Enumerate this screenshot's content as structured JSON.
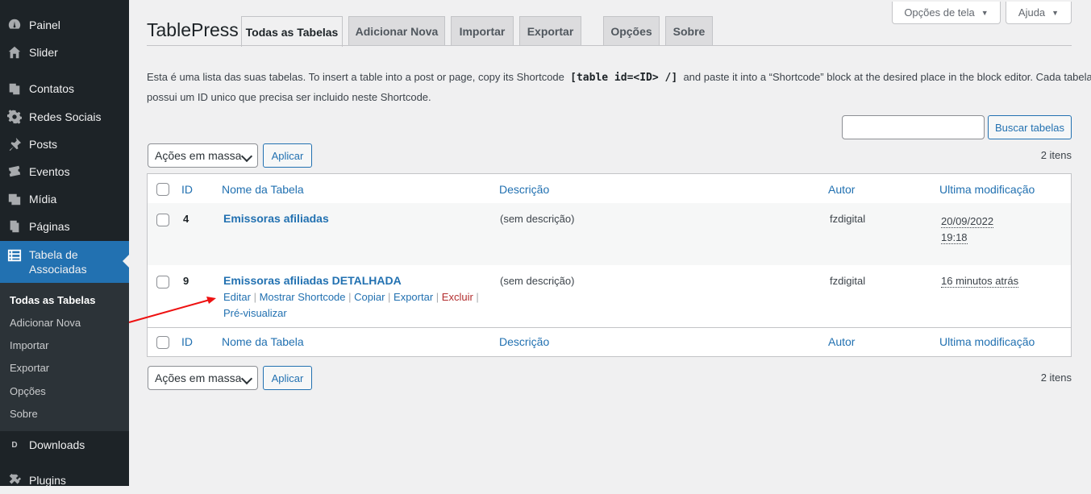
{
  "sidebar": {
    "items": [
      {
        "label": "Painel",
        "icon": "dashboard-icon"
      },
      {
        "label": "Slider",
        "icon": "home-icon"
      },
      {
        "label": "Contatos",
        "icon": "pages-icon"
      },
      {
        "label": "Redes Sociais",
        "icon": "gear-icon"
      },
      {
        "label": "Posts",
        "icon": "pin-icon"
      },
      {
        "label": "Eventos",
        "icon": "ticket-icon"
      },
      {
        "label": "Mídia",
        "icon": "media-icon"
      },
      {
        "label": "Páginas",
        "icon": "pages-icon"
      },
      {
        "label": "Tabela de Associadas",
        "icon": "table-icon"
      },
      {
        "label": "Downloads",
        "icon": "downloads-icon"
      },
      {
        "label": "Plugins",
        "icon": "plugin-icon"
      }
    ],
    "submenu": [
      "Todas as Tabelas",
      "Adicionar Nova",
      "Importar",
      "Exportar",
      "Opções",
      "Sobre"
    ],
    "accent": "#2271b1"
  },
  "screen_options": {
    "label": "Opções de tela",
    "help": "Ajuda"
  },
  "brand": "TablePress",
  "tabs": [
    "Todas as Tabelas",
    "Adicionar Nova",
    "Importar",
    "Exportar",
    "Opções",
    "Sobre"
  ],
  "intro": {
    "line1_a": "Esta é uma lista das suas tabelas. To insert a table into a post or page, copy its Shortcode",
    "shortcode": "[table id=<ID> /]",
    "line1_b": "and paste it into a “Shortcode” block at the desired place in the block editor. Cada tabela",
    "line2": "possui um ID unico que precisa ser incluido neste Shortcode."
  },
  "search": {
    "value": "",
    "button": "Buscar tabelas"
  },
  "bulk": {
    "select": "Ações em massa",
    "apply": "Aplicar",
    "count": "2 itens"
  },
  "table": {
    "headers": {
      "id": "ID",
      "name": "Nome da Tabela",
      "desc": "Descrição",
      "author": "Autor",
      "modified": "Ultima modificação"
    },
    "rows": [
      {
        "id": "4",
        "name": "Emissoras afiliadas",
        "desc": "(sem descrição)",
        "author": "fzdigital",
        "modified_date": "20/09/2022",
        "modified_time": "19:18"
      },
      {
        "id": "9",
        "name": "Emissoras afiliadas DETALHADA",
        "desc": "(sem descrição)",
        "author": "fzdigital",
        "modified": "16 minutos atrás"
      }
    ],
    "row_actions": [
      "Editar",
      "Mostrar Shortcode",
      "Copiar",
      "Exportar",
      "Excluir",
      "Pré-visualizar"
    ]
  }
}
